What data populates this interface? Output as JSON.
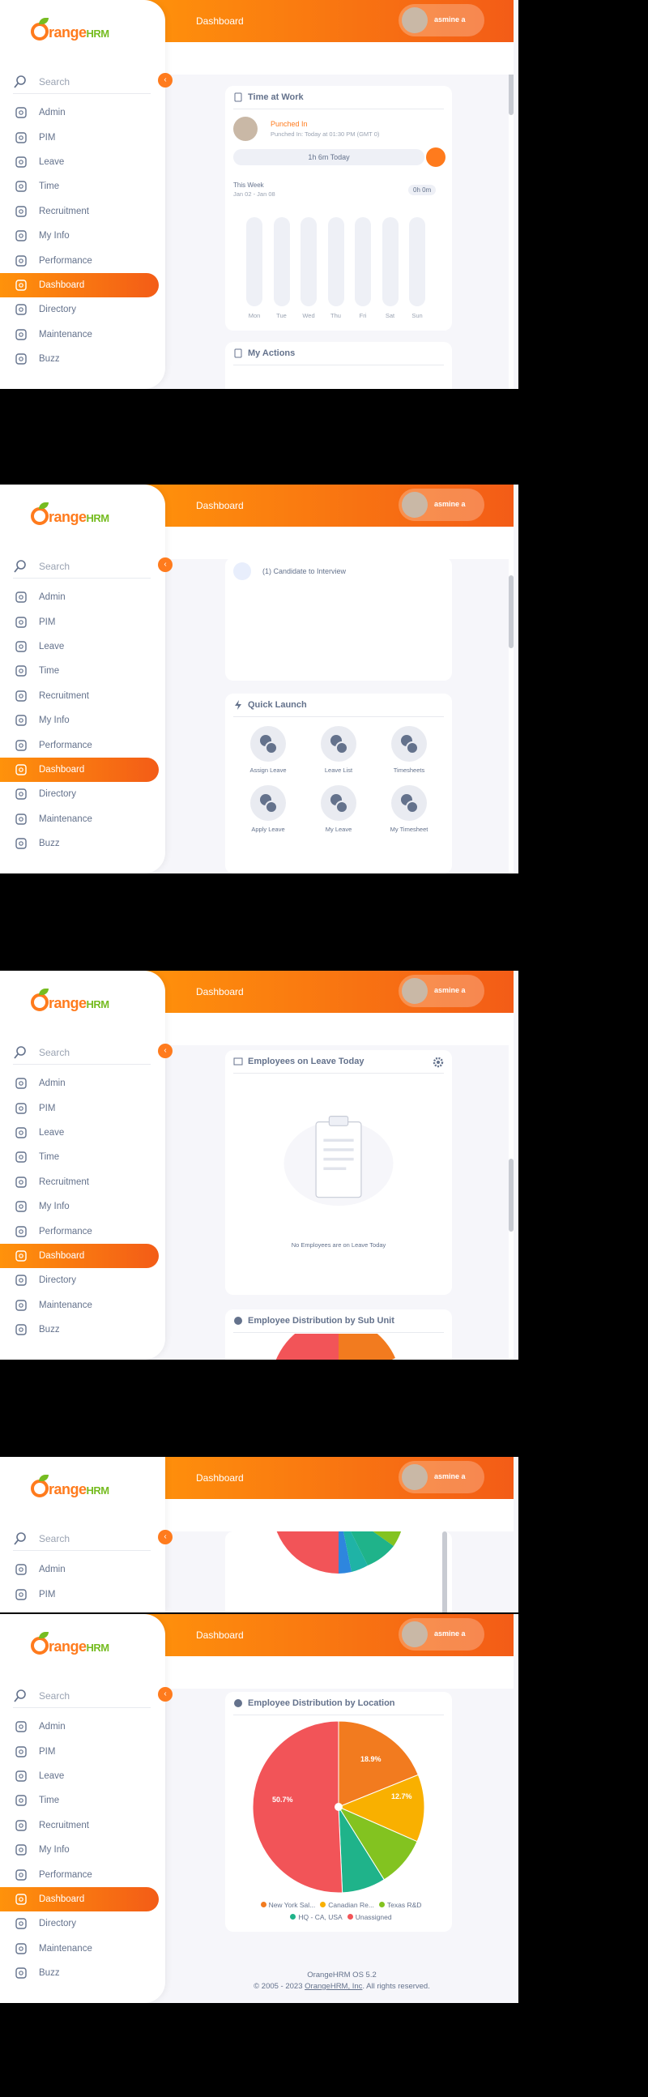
{
  "app": {
    "logo_text": "OrangeHRM",
    "page_title": "Dashboard",
    "user_name": "asmine a"
  },
  "search": {
    "placeholder": "Search"
  },
  "sidebar": {
    "items": [
      {
        "label": "Admin"
      },
      {
        "label": "PIM"
      },
      {
        "label": "Leave"
      },
      {
        "label": "Time"
      },
      {
        "label": "Recruitment"
      },
      {
        "label": "My Info"
      },
      {
        "label": "Performance"
      },
      {
        "label": "Dashboard"
      },
      {
        "label": "Directory"
      },
      {
        "label": "Maintenance"
      },
      {
        "label": "Buzz"
      }
    ]
  },
  "time_at_work": {
    "title": "Time at Work",
    "status": "Punched In",
    "punched_detail": "Punched In: Today at 01:30 PM (GMT 0)",
    "today_total": "1h 6m Today",
    "week_label": "This Week",
    "week_range": "Jan 02 - Jan 08",
    "week_total": "0h 0m",
    "days": [
      "Mon",
      "Tue",
      "Wed",
      "Thu",
      "Fri",
      "Sat",
      "Sun"
    ]
  },
  "my_actions": {
    "title": "My Actions",
    "item": "(1) Candidate to Interview"
  },
  "quick_launch": {
    "title": "Quick Launch",
    "items": [
      {
        "label": "Assign Leave"
      },
      {
        "label": "Leave List"
      },
      {
        "label": "Timesheets"
      },
      {
        "label": "Apply Leave"
      },
      {
        "label": "My Leave"
      },
      {
        "label": "My Timesheet"
      }
    ]
  },
  "leave_today": {
    "title": "Employees on Leave Today",
    "empty_text": "No Employees are on Leave Today"
  },
  "sub_unit": {
    "title": "Employee Distribution by Sub Unit"
  },
  "location": {
    "title": "Employee Distribution by Location",
    "legend": [
      {
        "label": "New York Sal...",
        "color": "#f27b1f"
      },
      {
        "label": "Canadian Re...",
        "color": "#f9b000"
      },
      {
        "label": "Texas R&D",
        "color": "#83c320"
      },
      {
        "label": "HQ - CA, USA",
        "color": "#1fb38a"
      },
      {
        "label": "Unassigned",
        "color": "#f25458"
      }
    ],
    "labels": {
      "a": "18.9%",
      "b": "12.7%",
      "c": "50.7%"
    }
  },
  "footer": {
    "version": "OrangeHRM OS 5.2",
    "copyright_prefix": "© 2005 - 2023 ",
    "company": "OrangeHRM, Inc",
    "suffix": ". All rights reserved."
  },
  "chart_data": {
    "type": "pie",
    "title": "Employee Distribution by Location",
    "categories": [
      "New York Sales Office",
      "Canadian Regional HQ",
      "Texas R&D",
      "HQ - CA, USA",
      "Unassigned"
    ],
    "values": [
      18.9,
      12.7,
      9.5,
      8.2,
      50.7
    ]
  }
}
